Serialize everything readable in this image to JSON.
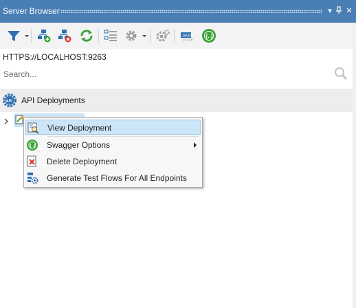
{
  "titlebar": {
    "title": "Server Browser",
    "buttons": [
      {
        "icon": "dropdown-arrow-icon",
        "glyph": "▾"
      },
      {
        "icon": "pin-icon",
        "glyph": "ꟼ"
      },
      {
        "icon": "close-icon",
        "glyph": "✕"
      }
    ],
    "color": "#4a7fb5"
  },
  "toolbar": {
    "tools": [
      {
        "name": "filter-icon",
        "has_dropdown": true
      },
      {
        "name": "add-server-icon"
      },
      {
        "name": "remove-server-icon"
      },
      {
        "name": "refresh-icon"
      },
      {
        "name": "list-view-icon"
      },
      {
        "name": "settings-icon",
        "has_dropdown": true
      },
      {
        "name": "disabled-settings-icon"
      },
      {
        "name": "json-icon"
      },
      {
        "name": "swagger-icon"
      }
    ]
  },
  "server": {
    "url": "HTTPS://LOCALHOST:9263"
  },
  "search": {
    "placeholder": "Search..."
  },
  "section": {
    "title": "API Deployments"
  },
  "context_menu": {
    "items": [
      {
        "label": "View Deployment",
        "icon": "view-deployment-icon",
        "highlighted": true
      },
      {
        "label": "Swagger Options",
        "icon": "swagger-icon",
        "submenu": true
      },
      {
        "label": "Delete Deployment",
        "icon": "delete-deployment-icon"
      },
      {
        "label": "Generate Test Flows For All Endpoints",
        "icon": "generate-test-flows-icon"
      }
    ]
  },
  "colors": {
    "selection": "#cce4f7",
    "swagger_green": "#3aa336",
    "accent_blue": "#2f6fb2"
  }
}
